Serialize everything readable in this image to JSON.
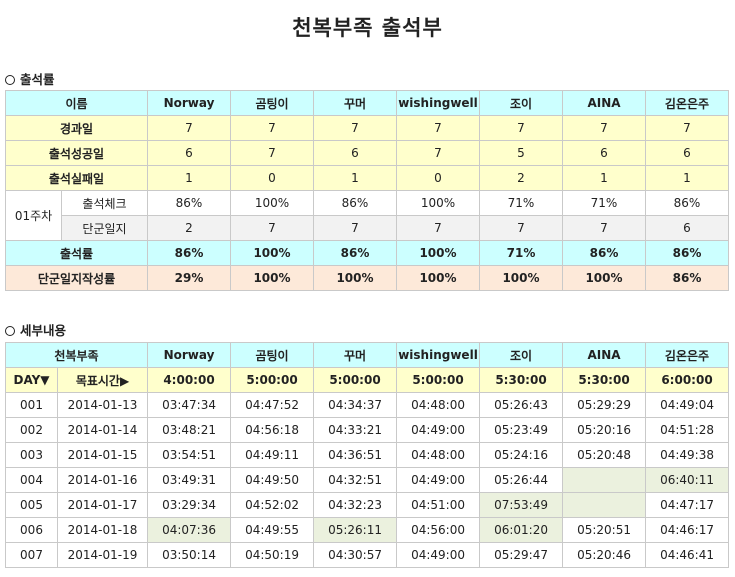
{
  "title": "천복부족 출석부",
  "section1": "출석률",
  "section2": "세부내용",
  "members": [
    "Norway",
    "곰팅이",
    "꾸머",
    "wishingwell",
    "조이",
    "AINA",
    "김온은주"
  ],
  "summary": {
    "name_label": "이름",
    "rows": [
      {
        "label": "경과일",
        "values": [
          "7",
          "7",
          "7",
          "7",
          "7",
          "7",
          "7"
        ]
      },
      {
        "label": "출석성공일",
        "values": [
          "6",
          "7",
          "6",
          "7",
          "5",
          "6",
          "6"
        ]
      },
      {
        "label": "출석실패일",
        "values": [
          "1",
          "0",
          "1",
          "0",
          "2",
          "1",
          "1"
        ]
      }
    ],
    "week_label": "01주차",
    "week_rows": [
      {
        "label": "출석체크",
        "values": [
          "86%",
          "100%",
          "86%",
          "100%",
          "71%",
          "71%",
          "86%"
        ]
      },
      {
        "label": "단군일지",
        "values": [
          "2",
          "7",
          "7",
          "7",
          "7",
          "7",
          "6"
        ]
      }
    ],
    "rate": {
      "label": "출석률",
      "values": [
        "86%",
        "100%",
        "86%",
        "100%",
        "71%",
        "86%",
        "86%"
      ]
    },
    "journal_rate": {
      "label": "단군일지작성률",
      "values": [
        "29%",
        "100%",
        "100%",
        "100%",
        "100%",
        "100%",
        "86%"
      ]
    }
  },
  "detail": {
    "tribe_label": "천복부족",
    "day_label": "DAY▼",
    "target_label": "목표시간▶",
    "targets": [
      "4:00:00",
      "5:00:00",
      "5:00:00",
      "5:00:00",
      "5:30:00",
      "5:30:00",
      "6:00:00"
    ],
    "rows": [
      {
        "day": "001",
        "date": "2014-01-13",
        "times": [
          "03:47:34",
          "04:47:52",
          "04:34:37",
          "04:48:00",
          "05:26:43",
          "05:29:29",
          "04:49:04"
        ]
      },
      {
        "day": "002",
        "date": "2014-01-14",
        "times": [
          "03:48:21",
          "04:56:18",
          "04:33:21",
          "04:49:00",
          "05:23:49",
          "05:20:16",
          "04:51:28"
        ]
      },
      {
        "day": "003",
        "date": "2014-01-15",
        "times": [
          "03:54:51",
          "04:49:11",
          "04:36:51",
          "04:48:00",
          "05:24:16",
          "05:20:48",
          "04:49:38"
        ]
      },
      {
        "day": "004",
        "date": "2014-01-16",
        "times": [
          "03:49:31",
          "04:49:50",
          "04:32:51",
          "04:49:00",
          "05:26:44",
          "",
          "06:40:11"
        ]
      },
      {
        "day": "005",
        "date": "2014-01-17",
        "times": [
          "03:29:34",
          "04:52:02",
          "04:32:23",
          "04:51:00",
          "07:53:49",
          "",
          "04:47:17"
        ]
      },
      {
        "day": "006",
        "date": "2014-01-18",
        "times": [
          "04:07:36",
          "04:49:55",
          "05:26:11",
          "04:56:00",
          "06:01:20",
          "05:20:51",
          "04:46:17"
        ]
      },
      {
        "day": "007",
        "date": "2014-01-19",
        "times": [
          "03:50:14",
          "04:50:19",
          "04:30:57",
          "04:49:00",
          "05:29:47",
          "05:20:46",
          "04:46:41"
        ]
      }
    ]
  }
}
